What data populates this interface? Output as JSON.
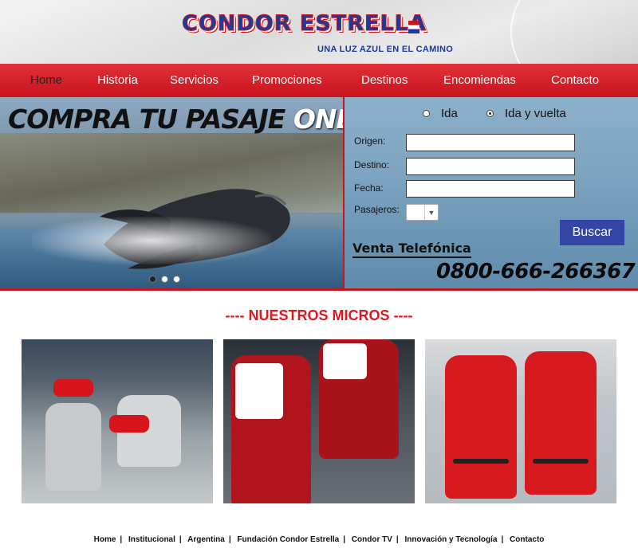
{
  "header": {
    "logo_text": "CONDOR ESTRELLA",
    "tagline": "UNA LUZ AZUL EN EL CAMINO"
  },
  "nav": {
    "items": [
      {
        "label": "Home",
        "active": true
      },
      {
        "label": "Historia"
      },
      {
        "label": "Servicios"
      },
      {
        "label": "Promociones"
      },
      {
        "label": "Destinos"
      },
      {
        "label": "Encomiendas"
      },
      {
        "label": "Contacto"
      }
    ]
  },
  "slider": {
    "title_part1": "COMPRA TU PASAJE",
    "title_part2": "ONLINE",
    "chevron": "❯",
    "slide_count": 3,
    "active_slide": 1
  },
  "search": {
    "trip_options": [
      {
        "label": "Ida",
        "checked": false
      },
      {
        "label": "Ida y vuelta",
        "checked": true
      }
    ],
    "origin_label": "Origen:",
    "origin_value": "",
    "destination_label": "Destino:",
    "destination_value": "",
    "date_label": "Fecha:",
    "date_value": "",
    "passengers_label": "Pasajeros:",
    "passengers_value": "",
    "submit_label": "Buscar",
    "phone_sales_label": "Venta Telefónica",
    "phone_number": "0800-666-266367"
  },
  "micros": {
    "title": "---- NUESTROS MICROS ----"
  },
  "footer": {
    "links": [
      "Home",
      "Institucional",
      "Argentina",
      "Fundación Condor Estrella",
      "Condor TV",
      "Innovación y Tecnología",
      "Contacto"
    ]
  },
  "colors": {
    "brand_red": "#c8141c",
    "brand_blue": "#3545a6",
    "heading_red": "#e0171e"
  }
}
